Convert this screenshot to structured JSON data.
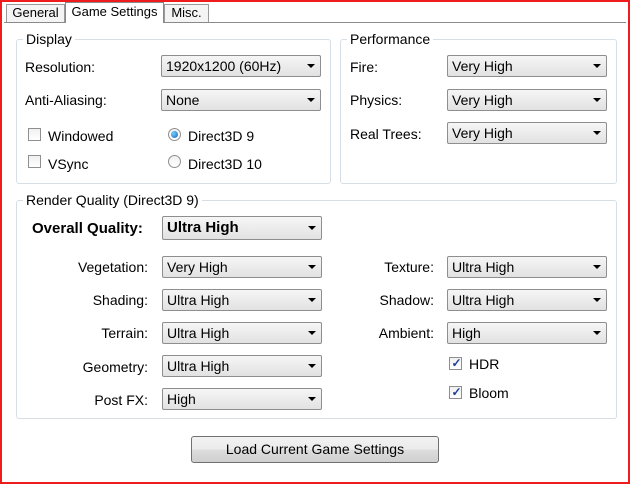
{
  "tabs": [
    {
      "label": "General"
    },
    {
      "label": "Game Settings"
    },
    {
      "label": "Misc."
    }
  ],
  "display": {
    "title": "Display",
    "resolution_label": "Resolution:",
    "resolution_value": "1920x1200 (60Hz)",
    "antialiasing_label": "Anti-Aliasing:",
    "antialiasing_value": "None",
    "windowed_label": "Windowed",
    "windowed_checked": false,
    "vsync_label": "VSync",
    "vsync_checked": false,
    "d3d9_label": "Direct3D 9",
    "d3d9_selected": true,
    "d3d10_label": "Direct3D 10",
    "d3d10_selected": false
  },
  "performance": {
    "title": "Performance",
    "fire_label": "Fire:",
    "fire_value": "Very High",
    "physics_label": "Physics:",
    "physics_value": "Very High",
    "realtrees_label": "Real Trees:",
    "realtrees_value": "Very High"
  },
  "render": {
    "title": "Render Quality (Direct3D 9)",
    "overall_label": "Overall Quality:",
    "overall_value": "Ultra High",
    "vegetation_label": "Vegetation:",
    "vegetation_value": "Very High",
    "shading_label": "Shading:",
    "shading_value": "Ultra High",
    "terrain_label": "Terrain:",
    "terrain_value": "Ultra High",
    "geometry_label": "Geometry:",
    "geometry_value": "Ultra High",
    "postfx_label": "Post FX:",
    "postfx_value": "High",
    "texture_label": "Texture:",
    "texture_value": "Ultra High",
    "shadow_label": "Shadow:",
    "shadow_value": "Ultra High",
    "ambient_label": "Ambient:",
    "ambient_value": "High",
    "hdr_label": "HDR",
    "hdr_checked": true,
    "bloom_label": "Bloom",
    "bloom_checked": true
  },
  "load_button_label": "Load Current Game Settings",
  "check_glyph": "✓",
  "colors": {
    "frame_border": "#ee1c1c",
    "group_border": "#d5dfe5",
    "radio_fill": "#1a5fb4"
  }
}
